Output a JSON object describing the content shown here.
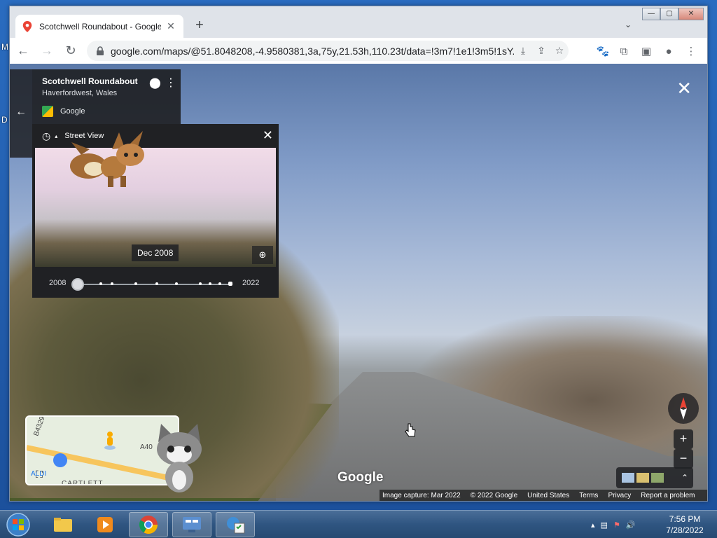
{
  "desktop": {
    "letters": [
      "M",
      "D"
    ]
  },
  "browser": {
    "tab_title": "Scotchwell Roundabout - Google",
    "tab_close": "✕",
    "new_tab": "+",
    "tab_menu": "⌄",
    "url": "google.com/maps/@51.8048208,-4.9580381,3a,75y,21.53h,110.23t/data=!3m7!1e1!3m5!1sY...",
    "window_controls": {
      "minimize": "—",
      "maximize": "▢",
      "close": "✕"
    }
  },
  "streetview": {
    "place_name": "Scotchwell Roundabout",
    "place_sub": "Haverfordwest, Wales",
    "source": "Google",
    "timemachine": {
      "header": "Street View",
      "date_label": "Dec 2008",
      "year_start": "2008",
      "year_end": "2022",
      "selected_fraction": 0
    },
    "watermark": "Google",
    "footer": {
      "capture": "Image capture: Mar 2022",
      "copyright": "© 2022 Google",
      "country": "United States",
      "terms": "Terms",
      "privacy": "Privacy",
      "report": "Report a problem"
    },
    "minimap": {
      "labels": [
        "B4329",
        "A40",
        "ALDI",
        "CARTLETT"
      ]
    },
    "zoom_in": "+",
    "zoom_out": "−"
  },
  "taskbar": {
    "time": "7:56 PM",
    "date": "7/28/2022"
  },
  "colors": {
    "accent_blue": "#1a73e8",
    "dark_panel": "#202124",
    "taskbar": "#2f5581"
  }
}
